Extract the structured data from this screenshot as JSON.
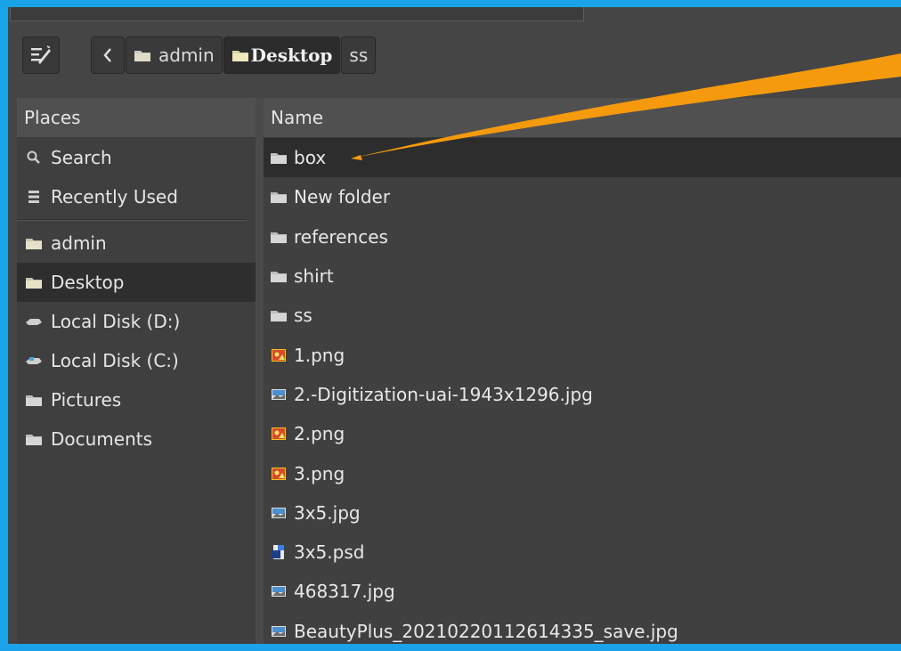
{
  "breadcrumb": {
    "items": [
      {
        "label": "admin",
        "active": false
      },
      {
        "label": "Desktop",
        "active": true
      },
      {
        "label": "ss",
        "active": false
      }
    ]
  },
  "places": {
    "header": "Places",
    "items": [
      {
        "label": "Search",
        "icon": "search-icon"
      },
      {
        "label": "Recently Used",
        "icon": "recent-icon"
      },
      {
        "label": "admin",
        "icon": "folder-icon"
      },
      {
        "label": "Desktop",
        "icon": "folder-icon",
        "selected": true
      },
      {
        "label": "Local Disk (D:)",
        "icon": "drive-icon"
      },
      {
        "label": "Local Disk (C:)",
        "icon": "drive-icon"
      },
      {
        "label": "Pictures",
        "icon": "folder-icon"
      },
      {
        "label": "Documents",
        "icon": "folder-icon"
      }
    ]
  },
  "file_list": {
    "header": "Name",
    "rows": [
      {
        "name": "box",
        "icon": "folder-icon",
        "selected": true
      },
      {
        "name": "New folder",
        "icon": "folder-icon"
      },
      {
        "name": "references",
        "icon": "folder-icon"
      },
      {
        "name": "shirt",
        "icon": "folder-icon"
      },
      {
        "name": "ss",
        "icon": "folder-icon"
      },
      {
        "name": "1.png",
        "icon": "png-image-icon"
      },
      {
        "name": "2.-Digitization-uai-1943x1296.jpg",
        "icon": "jpg-image-icon"
      },
      {
        "name": "2.png",
        "icon": "png-image-icon"
      },
      {
        "name": "3.png",
        "icon": "png-image-icon"
      },
      {
        "name": "3x5.jpg",
        "icon": "jpg-image-icon"
      },
      {
        "name": "3x5.psd",
        "icon": "psd-file-icon"
      },
      {
        "name": "468317.jpg",
        "icon": "jpg-image-icon"
      },
      {
        "name": "BeautyPlus_20210220112614335_save.jpg",
        "icon": "jpg-image-icon"
      }
    ]
  },
  "colors": {
    "frame_border": "#1aa3e8",
    "annotation_arrow": "#f59a0c",
    "window_bg": "#454545",
    "selected_row": "#2d2d2d"
  }
}
